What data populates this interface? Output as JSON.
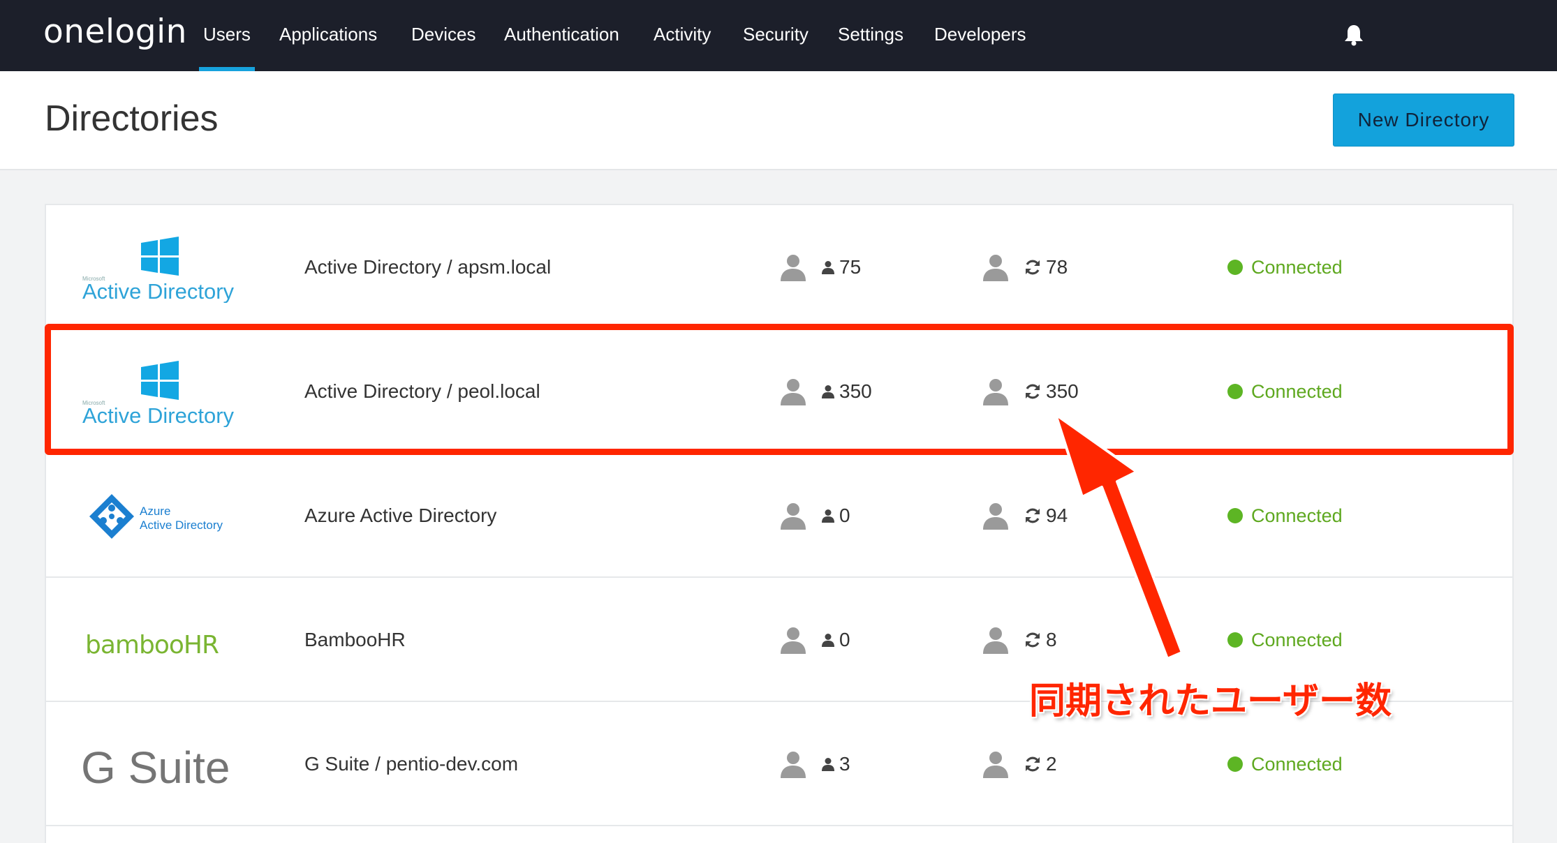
{
  "nav": {
    "brand": "onelogin",
    "items": [
      {
        "label": "Users",
        "active": true
      },
      {
        "label": "Applications",
        "active": false
      },
      {
        "label": "Devices",
        "active": false
      },
      {
        "label": "Authentication",
        "active": false
      },
      {
        "label": "Activity",
        "active": false
      },
      {
        "label": "Security",
        "active": false
      },
      {
        "label": "Settings",
        "active": false
      },
      {
        "label": "Developers",
        "active": false
      }
    ],
    "bell_icon": "bell-icon"
  },
  "header": {
    "title": "Directories",
    "new_button": "New Directory"
  },
  "directories": [
    {
      "logo": "microsoft-active-directory-logo",
      "logo_small": "Microsoft",
      "logo_text": "Active Directory",
      "name": "Active Directory / apsm.local",
      "users": "75",
      "synced": "78",
      "status": "Connected"
    },
    {
      "logo": "microsoft-active-directory-logo",
      "logo_small": "Microsoft",
      "logo_text": "Active Directory",
      "name": "Active Directory / peol.local",
      "users": "350",
      "synced": "350",
      "status": "Connected"
    },
    {
      "logo": "azure-active-directory-logo",
      "logo_small": "Azure",
      "logo_text": "Active Directory",
      "name": "Azure Active Directory",
      "users": "0",
      "synced": "94",
      "status": "Connected"
    },
    {
      "logo": "bamboohr-logo",
      "logo_small": "",
      "logo_text": "bambooHR",
      "name": "BambooHR",
      "users": "0",
      "synced": "8",
      "status": "Connected"
    },
    {
      "logo": "g-suite-logo",
      "logo_small": "",
      "logo_text": "G Suite",
      "name": "G Suite / pentio-dev.com",
      "users": "3",
      "synced": "2",
      "status": "Connected"
    }
  ],
  "annotation": {
    "text": "同期されたユーザー数"
  },
  "colors": {
    "nav_bg": "#1c1f2a",
    "accent": "#13a2dc",
    "status_green": "#5db524",
    "annotation_red": "#ff2600"
  }
}
